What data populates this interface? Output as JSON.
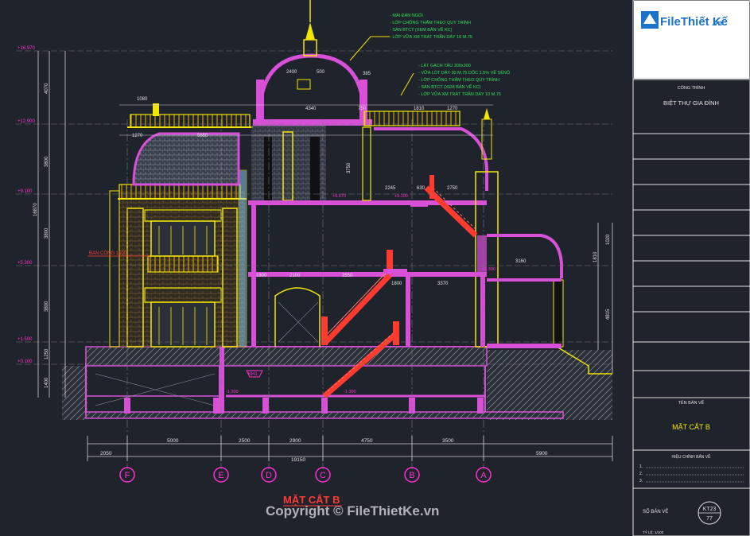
{
  "logo": {
    "brand_text": "FileThiết Kế",
    "domain_suffix": ".vn"
  },
  "title_block": {
    "project_label": "CÔNG TRÌNH",
    "project_name": "BIỆT THỰ GIA ĐÌNH",
    "drawing_label": "TÊN BẢN VẼ",
    "drawing_name": "MẶT CẮT B",
    "revision_label": "HIỆU CHỈNH BẢN VẼ",
    "revision_lines": [
      "1.",
      "2.",
      "3."
    ],
    "sheet_label": "SỐ BẢN VẼ",
    "sheet_code": "KT23",
    "sheet_number": "77",
    "scale_text": "TỶ LỆ: 1/100"
  },
  "drawing": {
    "section_title": "MẶT CẮT B",
    "watermark": "Copyright © FileThietKe.vn",
    "roof_notes": [
      "- MÁI ĐÁN NGÓI",
      "- LỚP CHỐNG THẤM THEO QUY TRÌNH",
      "- SÀN BTCT (XEM BẢN VẼ KC)",
      "- LỚP VỮA XM TRÁT TRẦN DÀY 10 M.75"
    ],
    "floor_notes": [
      "- LÁT GẠCH TÀU 300x300",
      "- VỮA LÓT DÀY 30 M.75 DỐC 1.5% VỀ SÊNÔ",
      "- LỚP CHỐNG THẤM THEO QUY TRÌNH",
      "- SÀN BTCT (XEM BẢN VẼ KC)",
      "- LỚP VỮA XM TRÁT TRẦN DÀY 10 M.75"
    ],
    "balcony_note": "BAN CÔNG 1500",
    "levels": [
      "+16.970",
      "+12.900",
      "+9.100",
      "+5.300",
      "+1.500",
      "+0.100"
    ],
    "inner_levels": [
      "+9.670",
      "+9.100",
      "+5.300",
      "-1.300",
      "-1.300"
    ],
    "left_dims": [
      "4070",
      "3800",
      "3800",
      "3800",
      "1250",
      "1400",
      "16870"
    ],
    "right_dims": [
      "1020",
      "1810",
      "4815"
    ],
    "top_dims": [
      "2400",
      "500",
      "385",
      "1080",
      "1270",
      "5650",
      "4340",
      "750",
      "1810",
      "1270"
    ],
    "mid_dims": [
      "3750",
      "2245",
      "630",
      "2750",
      "3160",
      "2100",
      "3550",
      "1800",
      "3370",
      "1800"
    ],
    "bottom_dims": [
      "5000",
      "2500",
      "2900",
      "4750",
      "3500"
    ],
    "bottom_outer_dims": [
      "2050",
      "19150",
      "5900"
    ],
    "axis_labels": [
      "F",
      "E",
      "D",
      "C",
      "B",
      "A"
    ],
    "marker": "KH1"
  },
  "colors": {
    "background": "#1f232c",
    "wall": "#d84fd8",
    "structure": "#f2e600",
    "stair": "#ff3b30",
    "note": "#32e05a",
    "axis": "#ff2fd0",
    "dim": "#e0e0e0",
    "roof": "#8a8fa0"
  }
}
